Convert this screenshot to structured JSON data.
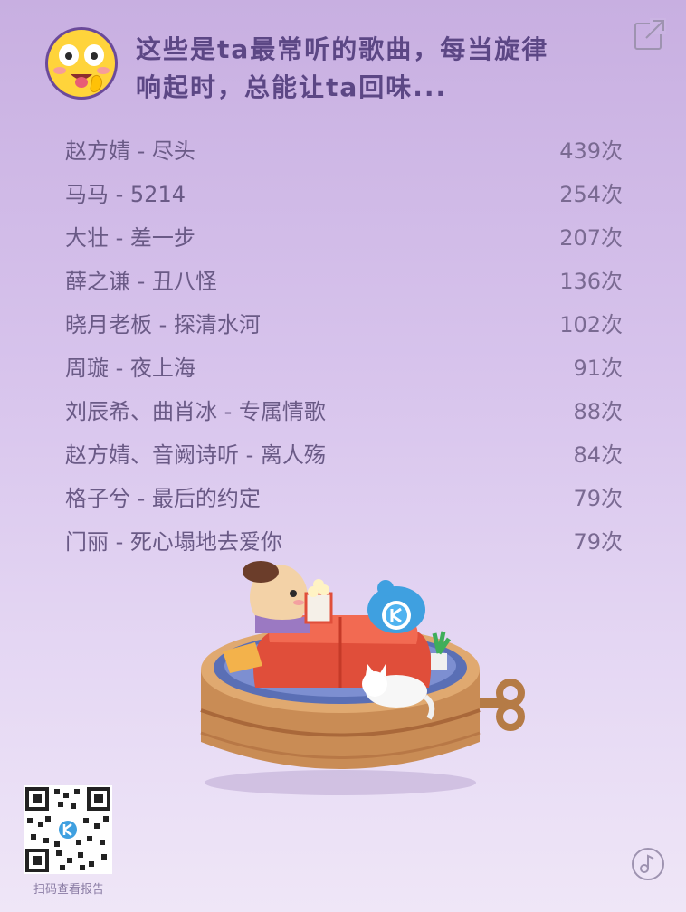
{
  "header": {
    "line1": "这些是ta最常听的歌曲，每当旋律",
    "line2": "响起时，总能让ta回味..."
  },
  "songs": [
    {
      "title": "赵方婧 - 尽头",
      "count": "439次"
    },
    {
      "title": "马马 - 5214",
      "count": "254次"
    },
    {
      "title": "大壮 - 差一步",
      "count": "207次"
    },
    {
      "title": "薛之谦 - 丑八怪",
      "count": "136次"
    },
    {
      "title": "晓月老板 - 探清水河",
      "count": "102次"
    },
    {
      "title": "周璇 - 夜上海",
      "count": "91次"
    },
    {
      "title": "刘辰希、曲肖冰 - 专属情歌",
      "count": "88次"
    },
    {
      "title": "赵方婧、音阙诗听 - 离人殇",
      "count": "84次"
    },
    {
      "title": "格子兮 - 最后的约定",
      "count": "79次"
    },
    {
      "title": "门丽 - 死心塌地去爱你",
      "count": "79次"
    }
  ],
  "qr": {
    "caption": "扫码查看报告"
  },
  "icons": {
    "avatar": "shocked-emoji-icon",
    "share": "share-external-icon",
    "music": "music-note-icon"
  },
  "colors": {
    "headline": "#5c4785",
    "text": "#6a5a86"
  }
}
